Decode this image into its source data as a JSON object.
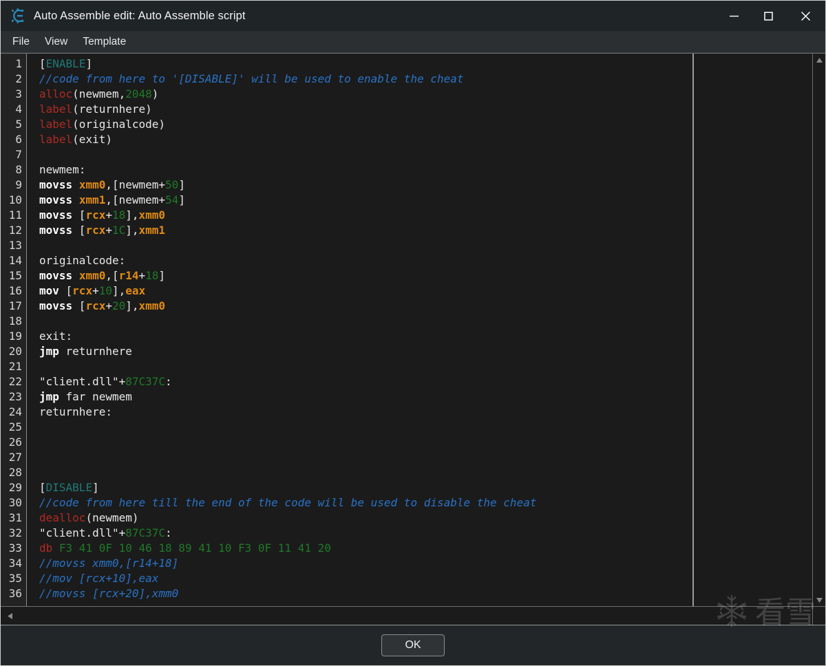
{
  "window": {
    "title": "Auto Assemble edit: Auto Assemble script",
    "icon": "cheat-engine-logo-icon",
    "controls": {
      "minimize": "minimize-icon",
      "maximize": "maximize-icon",
      "close": "close-icon"
    }
  },
  "menubar": {
    "items": [
      {
        "label": "File"
      },
      {
        "label": "View"
      },
      {
        "label": "Template"
      }
    ]
  },
  "editor": {
    "first_line": 1,
    "last_line": 36,
    "line_numbers": [
      "1",
      "2",
      "3",
      "4",
      "5",
      "6",
      "7",
      "8",
      "9",
      "10",
      "11",
      "12",
      "13",
      "14",
      "15",
      "16",
      "17",
      "18",
      "19",
      "20",
      "21",
      "22",
      "23",
      "24",
      "25",
      "26",
      "27",
      "28",
      "29",
      "30",
      "31",
      "32",
      "33",
      "34",
      "35",
      "36"
    ],
    "lines": [
      {
        "n": 1,
        "text": "[ENABLE]"
      },
      {
        "n": 2,
        "text": "//code from here to '[DISABLE]' will be used to enable the cheat"
      },
      {
        "n": 3,
        "text": "alloc(newmem,2048)"
      },
      {
        "n": 4,
        "text": "label(returnhere)"
      },
      {
        "n": 5,
        "text": "label(originalcode)"
      },
      {
        "n": 6,
        "text": "label(exit)"
      },
      {
        "n": 7,
        "text": ""
      },
      {
        "n": 8,
        "text": "newmem:"
      },
      {
        "n": 9,
        "text": "movss xmm0,[newmem+50]"
      },
      {
        "n": 10,
        "text": "movss xmm1,[newmem+54]"
      },
      {
        "n": 11,
        "text": "movss [rcx+18],xmm0"
      },
      {
        "n": 12,
        "text": "movss [rcx+1C],xmm1"
      },
      {
        "n": 13,
        "text": ""
      },
      {
        "n": 14,
        "text": "originalcode:"
      },
      {
        "n": 15,
        "text": "movss xmm0,[r14+18]"
      },
      {
        "n": 16,
        "text": "mov [rcx+10],eax"
      },
      {
        "n": 17,
        "text": "movss [rcx+20],xmm0"
      },
      {
        "n": 18,
        "text": ""
      },
      {
        "n": 19,
        "text": "exit:"
      },
      {
        "n": 20,
        "text": "jmp returnhere"
      },
      {
        "n": 21,
        "text": ""
      },
      {
        "n": 22,
        "text": "\"client.dll\"+87C37C:"
      },
      {
        "n": 23,
        "text": "jmp far newmem"
      },
      {
        "n": 24,
        "text": "returnhere:"
      },
      {
        "n": 25,
        "text": ""
      },
      {
        "n": 26,
        "text": ""
      },
      {
        "n": 27,
        "text": ""
      },
      {
        "n": 28,
        "text": ""
      },
      {
        "n": 29,
        "text": "[DISABLE]"
      },
      {
        "n": 30,
        "text": "//code from here till the end of the code will be used to disable the cheat"
      },
      {
        "n": 31,
        "text": "dealloc(newmem)"
      },
      {
        "n": 32,
        "text": "\"client.dll\"+87C37C:"
      },
      {
        "n": 33,
        "text": "db F3 41 0F 10 46 18 89 41 10 F3 0F 11 41 20"
      },
      {
        "n": 34,
        "text": "//movss xmm0,[r14+18]"
      },
      {
        "n": 35,
        "text": "//mov [rcx+10],eax"
      },
      {
        "n": 36,
        "text": "//movss [rcx+20],xmm0"
      }
    ],
    "colors": {
      "background": "#1b1b1b",
      "gutter_background": "#232323",
      "keyword": "#b02a23",
      "section": "#1f7a78",
      "comment": "#2a72c6",
      "number": "#1f7a28",
      "register": "#e08b12",
      "mnemonic": "#ffffff",
      "plain": "#e8e8e8"
    }
  },
  "scrollbars": {
    "vertical_up": "scroll-up-arrow-icon",
    "vertical_down": "scroll-down-arrow-icon",
    "horizontal_left": "scroll-left-arrow-icon"
  },
  "footer": {
    "ok_label": "OK"
  },
  "watermark": {
    "icon": "snowflake-icon",
    "text": "看雪"
  }
}
